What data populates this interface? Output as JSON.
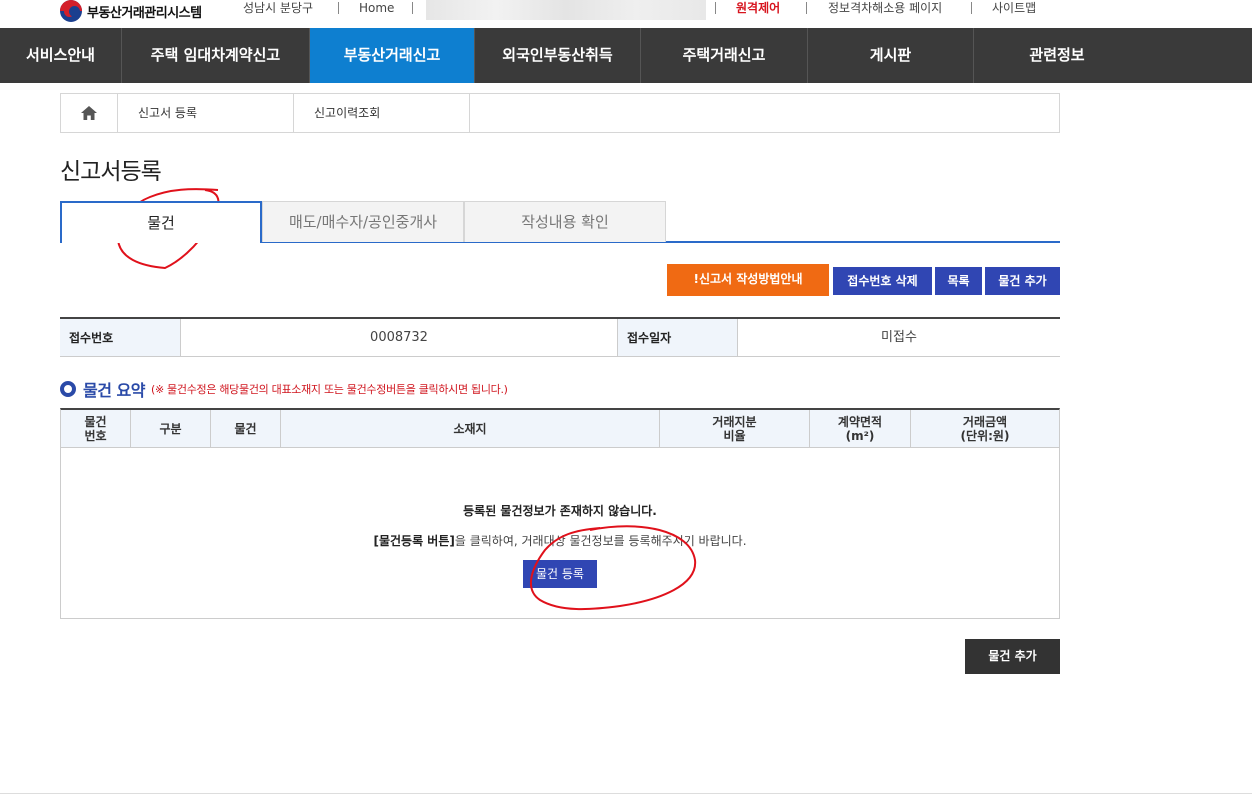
{
  "topbar": {
    "logo_text": "부동산거래관리시스템",
    "region": "성남시 분당구",
    "home": "Home",
    "remote_control": "원격제어",
    "info_gap_page": "정보격차해소용 페이지",
    "sitemap": "사이트맵"
  },
  "nav": {
    "items": [
      "서비스안내",
      "주택 임대차계약신고",
      "부동산거래신고",
      "외국인부동산취득",
      "주택거래신고",
      "게시판",
      "관련정보"
    ],
    "active_index": 2
  },
  "subnav": {
    "items": [
      "신고서 등록",
      "신고이력조회"
    ]
  },
  "page": {
    "title": "신고서등록"
  },
  "tabs": [
    "물건",
    "매도/매수자/공인중개사",
    "작성내용 확인"
  ],
  "actions": {
    "guide": "!신고서 작성방법안내",
    "delete_receipt": "접수번호 삭제",
    "list": "목록",
    "add_item": "물건 추가"
  },
  "info": {
    "receipt_no_label": "접수번호",
    "receipt_no": "0008732",
    "receipt_date_label": "접수일자",
    "receipt_date": "미접수"
  },
  "summary": {
    "title": "물건 요약",
    "note": "(※ 물건수정은 해당물건의 대표소재지 또는 물건수정버튼을 클릭하시면 됩니다.)",
    "columns": [
      "물건\n번호",
      "구분",
      "물건",
      "소재지",
      "거래지분\n비율",
      "계약면적\n(m²)",
      "거래금액\n(단위:원)"
    ],
    "empty_title": "등록된 물건정보가 존재하지 않습니다.",
    "empty_desc_bold": "[물건등록 버튼]",
    "empty_desc_rest": "을 클릭하여, 거래대상 물건정보를 등록해주시기 바랍니다.",
    "register_button": "물건 등록"
  },
  "bottom": {
    "add_item": "물건 추가"
  },
  "colors": {
    "nav_bg": "#3a3a3a",
    "nav_active": "#0e7fd0",
    "btn_blue": "#3046b3",
    "btn_orange": "#f06a13",
    "remote_red": "#d7141e"
  }
}
